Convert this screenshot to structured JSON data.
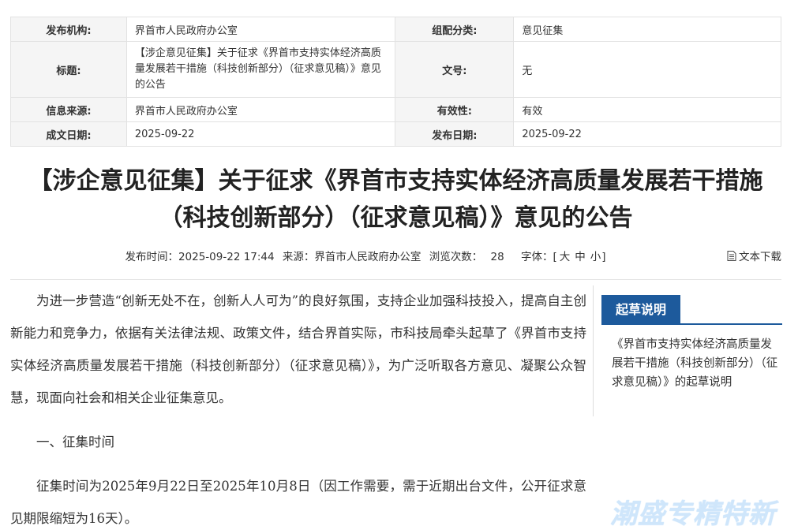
{
  "meta": {
    "publisher_label": "发布机构:",
    "publisher": "界首市人民政府办公室",
    "category_label": "组配分类:",
    "category": "意见征集",
    "title_label": "标题:",
    "title": "【涉企意见征集】关于征求《界首市支持实体经济高质量发展若干措施（科技创新部分）（征求意见稿）》意见的公告",
    "docno_label": "文号:",
    "docno": "无",
    "source_label": "信息来源:",
    "source": "界首市人民政府办公室",
    "validity_label": "有效性:",
    "validity": "有效",
    "created_label": "成文日期:",
    "created": "2025-09-22",
    "published_label": "发布日期:",
    "published": "2025-09-22"
  },
  "headline": "【涉企意见征集】关于征求《界首市支持实体经济高质量发展若干措施（科技创新部分）（征求意见稿）》意见的公告",
  "info": {
    "publish_time": "发布时间：2025-09-22 17:44",
    "source": "来源：界首市人民政府办公室",
    "views_label": "浏览次数：",
    "views": "28",
    "font_label": "字体：",
    "font_bracket_open": "[",
    "font_large": "大",
    "font_medium": "中",
    "font_small": "小",
    "font_bracket_close": "]",
    "download": "文本下载"
  },
  "article": {
    "p1": "为进一步营造“创新无处不在，创新人人可为”的良好氛围，支持企业加强科技投入，提高自主创新能力和竞争力，依据有关法律法规、政策文件，结合界首实际，市科技局牵头起草了《界首市支持实体经济高质量发展若干措施（科技创新部分）（征求意见稿）》，为广泛听取各方意见、凝聚公众智慧，现面向社会和相关企业征集意见。",
    "section1": "一、征集时间",
    "p2": "征集时间为2025年9月22日至2025年10月8日（因工作需要，需于近期出台文件，公开征求意见期限缩短为16天）。"
  },
  "sidebar": {
    "tab": "起草说明",
    "link": "《界首市支持实体经济高质量发展若干措施（科技创新部分）（征求意见稿）》的起草说明"
  },
  "watermark": "潮盛专精特新"
}
